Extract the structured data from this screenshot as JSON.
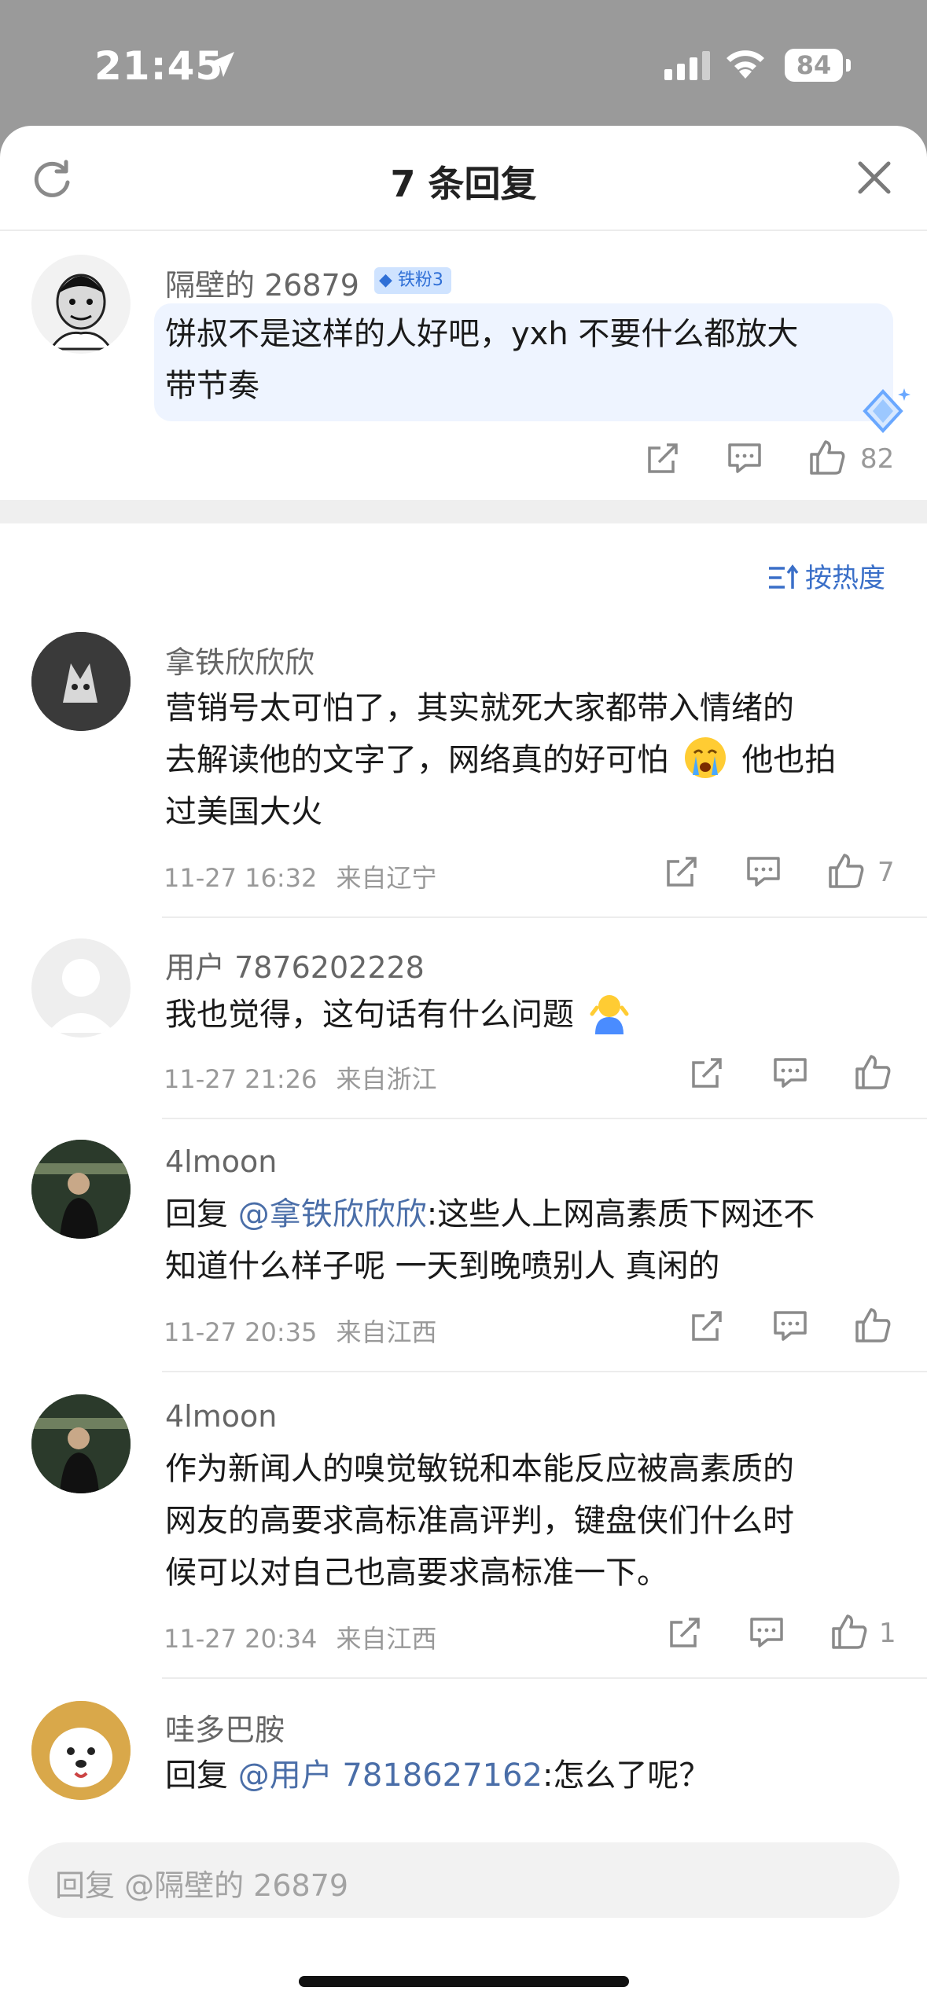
{
  "status_bar": {
    "time": "21:45",
    "battery": "84"
  },
  "header": {
    "title": "7 条回复"
  },
  "main_comment": {
    "username": "隔壁的 26879",
    "badge": "铁粉3",
    "text_line1": "饼叔不是这样的人好吧，yxh 不要什么都放大",
    "text_line2": "带节奏",
    "likes": "82"
  },
  "sort_label": "按热度",
  "replies": [
    {
      "username": "拿铁欣欣欣",
      "lines": [
        "营销号太可怕了，其实就死大家都带入情绪的",
        "去解读他的文字了，网络真的好可怕",
        "过美国大火"
      ],
      "line2_tail": "他也拍",
      "time": "11-27 16:32",
      "location": "来自辽宁",
      "likes": "7"
    },
    {
      "username": "用户 7876202228",
      "lines": [
        "我也觉得，这句话有什么问题"
      ],
      "time": "11-27 21:26",
      "location": "来自浙江",
      "likes": ""
    },
    {
      "username": "4lmoon",
      "reply_prefix": "回复 ",
      "mention": "@拿铁欣欣欣",
      "lines": [
        ":这些人上网高素质下网还不",
        "知道什么样子呢 一天到晚喷别人 真闲的"
      ],
      "time": "11-27 20:35",
      "location": "来自江西",
      "likes": ""
    },
    {
      "username": "4lmoon",
      "lines": [
        "作为新闻人的嗅觉敏锐和本能反应被高素质的",
        "网友的高要求高标准高评判，键盘侠们什么时",
        "候可以对自己也高要求高标准一下。"
      ],
      "time": "11-27 20:34",
      "location": "来自江西",
      "likes": "1"
    },
    {
      "username": "哇多巴胺",
      "reply_prefix": "回复 ",
      "mention": "@用户 7818627162",
      "lines": [
        ":怎么了呢？"
      ]
    }
  ],
  "reply_input": {
    "placeholder": "回复 @隔壁的 26879"
  },
  "colors": {
    "accent": "#3a6fc8",
    "mention": "#4a6ea8",
    "bubble": "#eef4ff",
    "badge": "#cfe3ff"
  }
}
